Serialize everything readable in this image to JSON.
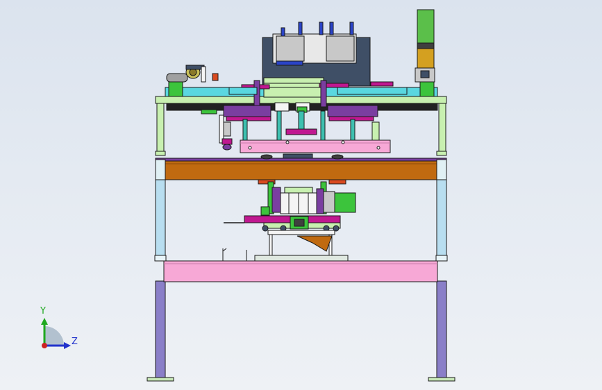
{
  "window": {
    "title": "",
    "background_top": "#dbe3ee",
    "background_bottom": "#eef1f5"
  },
  "triad": {
    "y_label": "Y",
    "z_label": "Z",
    "y_color": "#1fa81f",
    "z_color": "#2233cc",
    "x_color": "#cc2222"
  },
  "model": {
    "colors": {
      "frame_outline": "#1a1a1a",
      "top_plate": "#5ad7e0",
      "wood_plate": "#c06a10",
      "pink_beam": "#f7a8d6",
      "leg_upper": "#b8def0",
      "leg_lower": "#8a7fc8",
      "light_green": "#c8f0b0",
      "green": "#3cc43c",
      "magenta": "#c01890",
      "purple": "#7a3ea0",
      "dark_block": "#3f4f66",
      "blue": "#2b44c8",
      "gold": "#d4a020",
      "teal": "#3ec0b0"
    }
  }
}
